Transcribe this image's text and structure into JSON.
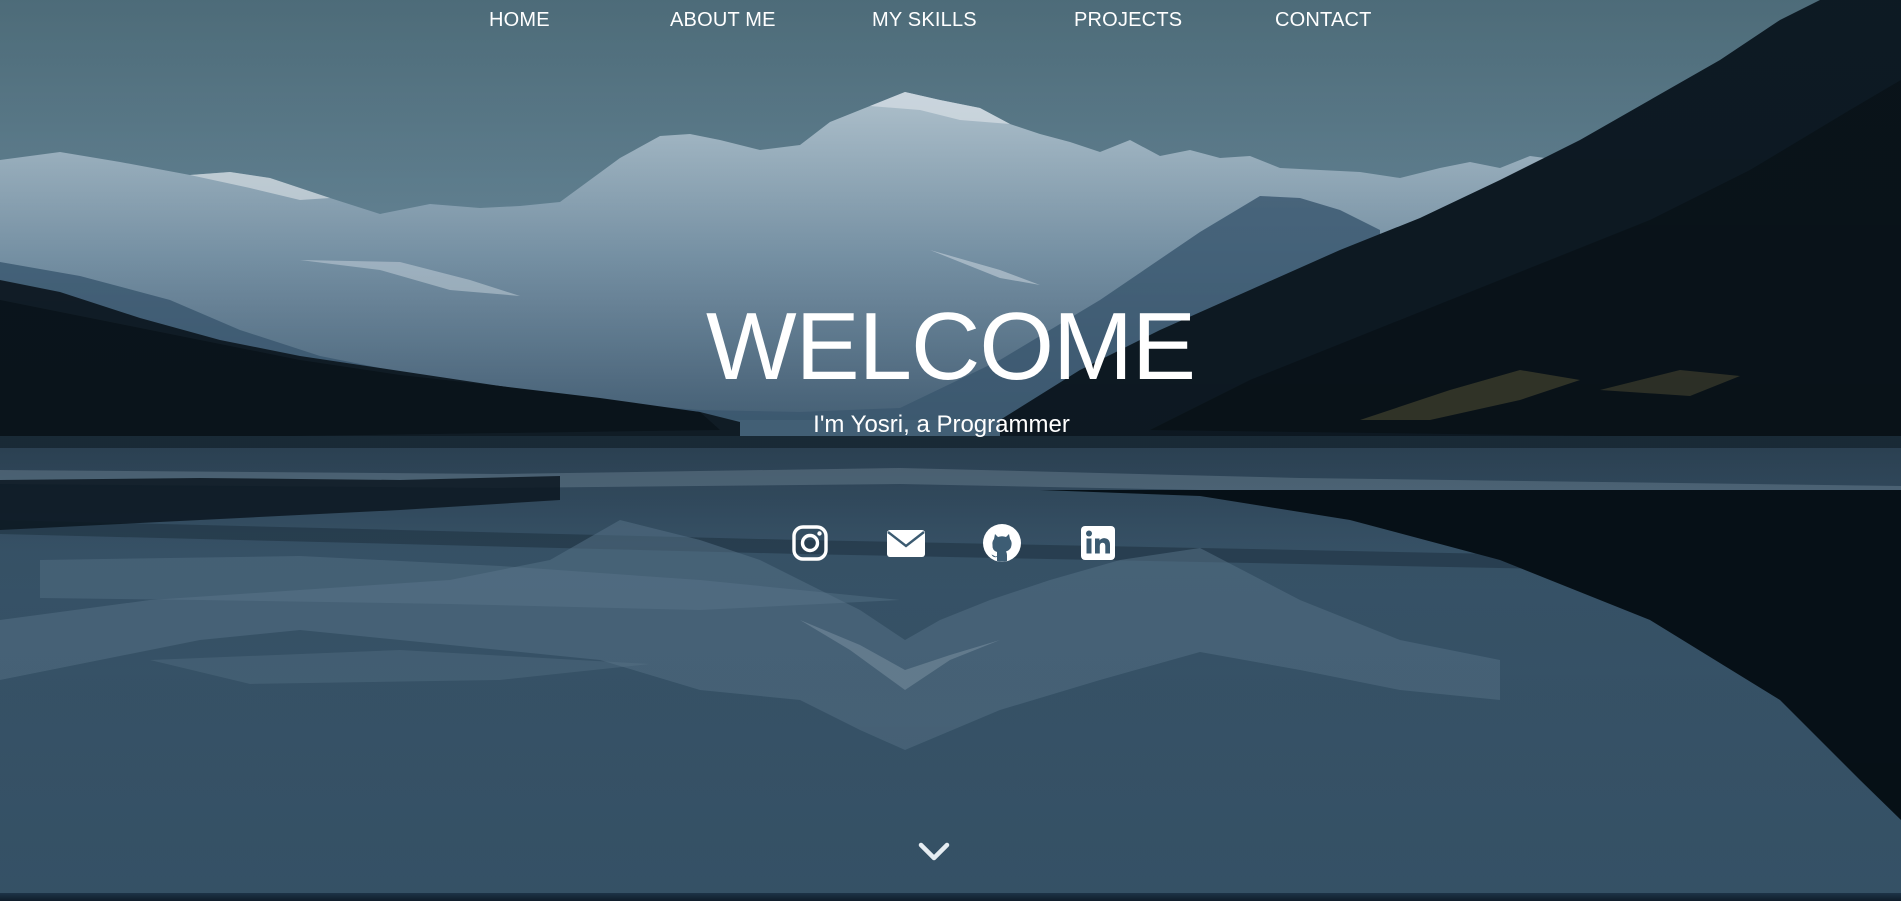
{
  "nav": {
    "items": [
      {
        "label": "HOME"
      },
      {
        "label": "ABOUT ME"
      },
      {
        "label": "MY SKILLS"
      },
      {
        "label": "PROJECTS"
      },
      {
        "label": "CONTACT"
      }
    ]
  },
  "hero": {
    "title": "WELCOME",
    "subtitle": "I'm Yosri, a Programmer"
  },
  "social": {
    "links": [
      {
        "icon": "instagram-icon"
      },
      {
        "icon": "envelope-icon"
      },
      {
        "icon": "github-icon"
      },
      {
        "icon": "linkedin-icon"
      }
    ]
  },
  "scroll": {
    "icon": "chevron-down-icon"
  },
  "colors": {
    "sky": "#5f7f93",
    "text": "#ffffff",
    "water": "#3d5d74"
  }
}
